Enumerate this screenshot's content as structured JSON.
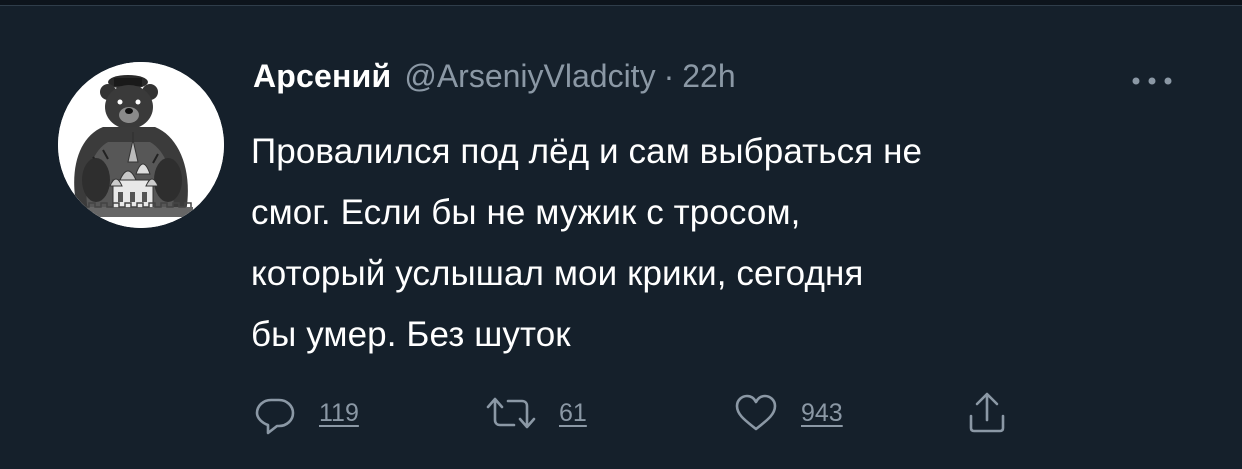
{
  "tweet": {
    "author_name": "Арсений",
    "handle": "@ArseniyVladcity",
    "separator": "·",
    "time": "22h",
    "text_lines": [
      "Провалился под лёд и сам выбраться не",
      "смог. Если бы не мужик с тросом,",
      "который услышал мои крики, сегодня",
      "бы умер. Без шуток"
    ]
  },
  "actions": {
    "reply": {
      "icon": "reply-bubble-icon",
      "count": "119"
    },
    "retweet": {
      "icon": "retweet-arrows-icon",
      "count": "61"
    },
    "like": {
      "icon": "heart-icon",
      "count": "943"
    },
    "share": {
      "icon": "share-upload-icon"
    }
  },
  "more_icon": "more-dots-icon",
  "avatar": {
    "description_icon": "bear-with-kremlin-avatar"
  },
  "colors": {
    "background": "#15202b",
    "primary_text": "#ffffff",
    "secondary_text": "#8b98a5"
  }
}
